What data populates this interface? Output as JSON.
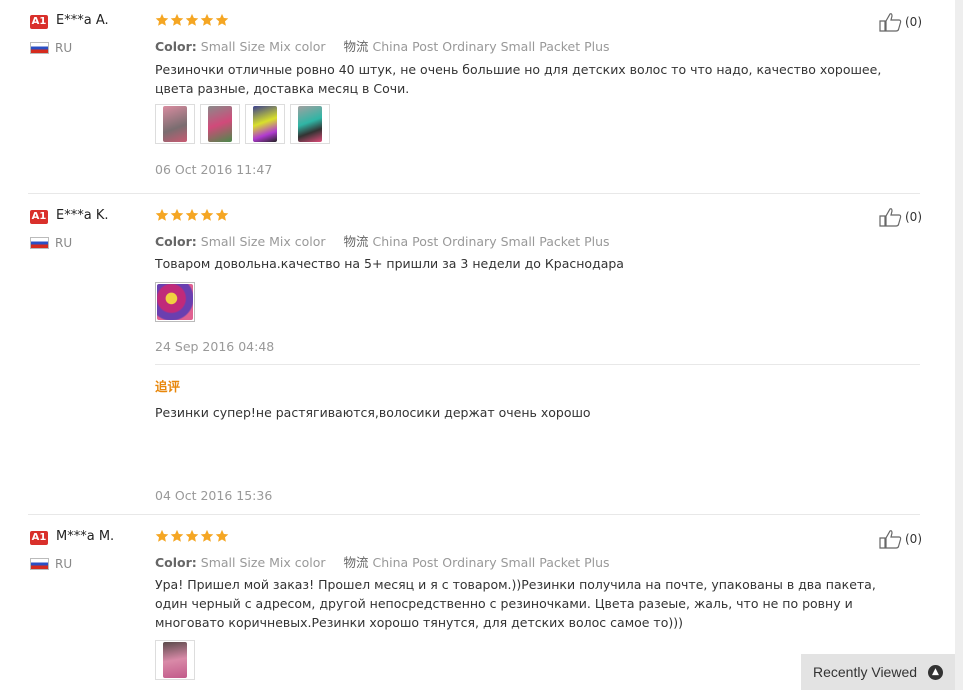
{
  "reviews": [
    {
      "badge": "A1",
      "name": "E***a A.",
      "country": "RU",
      "rating": 5,
      "color_key": "Color:",
      "color_value": "Small Size Mix color",
      "shipping_key": "物流",
      "shipping_value": "China Post Ordinary Small Packet Plus",
      "text": "Резиночки отличные ровно 40 штук, не очень большие но для детских волос то что надо, качество хорошее, цвета разные, доставка месяц в Сочи.",
      "photo_count": 4,
      "date": "06 Oct 2016 11:47",
      "helpful": "(0)"
    },
    {
      "badge": "A1",
      "name": "E***a K.",
      "country": "RU",
      "rating": 5,
      "color_key": "Color:",
      "color_value": "Small Size Mix color",
      "shipping_key": "物流",
      "shipping_value": "China Post Ordinary Small Packet Plus",
      "text": "Товаром довольна.качество на 5+ пришли за 3 недели до Краснодара",
      "photo_count": 1,
      "date": "24 Sep 2016 04:48",
      "followup_label": "追评",
      "followup_text": "Резинки супер!не растягиваются,волосики держат очень хорошо",
      "followup_date": "04 Oct 2016 15:36",
      "helpful": "(0)"
    },
    {
      "badge": "A1",
      "name": "M***a M.",
      "country": "RU",
      "rating": 5,
      "color_key": "Color:",
      "color_value": "Small Size Mix color",
      "shipping_key": "物流",
      "shipping_value": "China Post Ordinary Small Packet Plus",
      "text": "Ура! Пришел мой заказ! Прошел месяц и я с товаром.))Резинки получила на почте, упакованы в два пакета, один черный с адресом, другой непосредственно с резиночками. Цвета разеые, жаль, что не по ровну и многовато коричневых.Резинки хорошо тянутся, для детских волос самое то)))",
      "photo_count": 1,
      "helpful": "(0)"
    }
  ],
  "recently_viewed": {
    "label": "Recently Viewed",
    "icon": "chevron-up-icon"
  },
  "colors": {
    "badge": "#d9302b",
    "star": "#f5a623",
    "followup": "#e8870b"
  }
}
